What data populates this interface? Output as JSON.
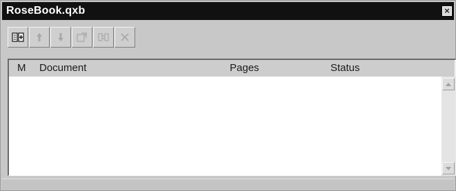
{
  "window": {
    "title": "RoseBook.qxb",
    "close_glyph": "×"
  },
  "toolbar": {
    "buttons": [
      {
        "icon": "add-document-icon",
        "enabled": true
      },
      {
        "icon": "move-up-arrow-icon",
        "enabled": false
      },
      {
        "icon": "move-down-arrow-icon",
        "enabled": false
      },
      {
        "icon": "open-document-icon",
        "enabled": false
      },
      {
        "icon": "synchronize-icon",
        "enabled": false
      },
      {
        "icon": "remove-document-icon",
        "enabled": false
      }
    ]
  },
  "list": {
    "columns": {
      "m": "M",
      "document": "Document",
      "pages": "Pages",
      "status": "Status"
    },
    "rows": []
  },
  "colors": {
    "title_bar": "#111111",
    "window_bg": "#c8c8c8",
    "list_bg": "#ffffff",
    "disabled_icon": "#a8a8a8"
  }
}
